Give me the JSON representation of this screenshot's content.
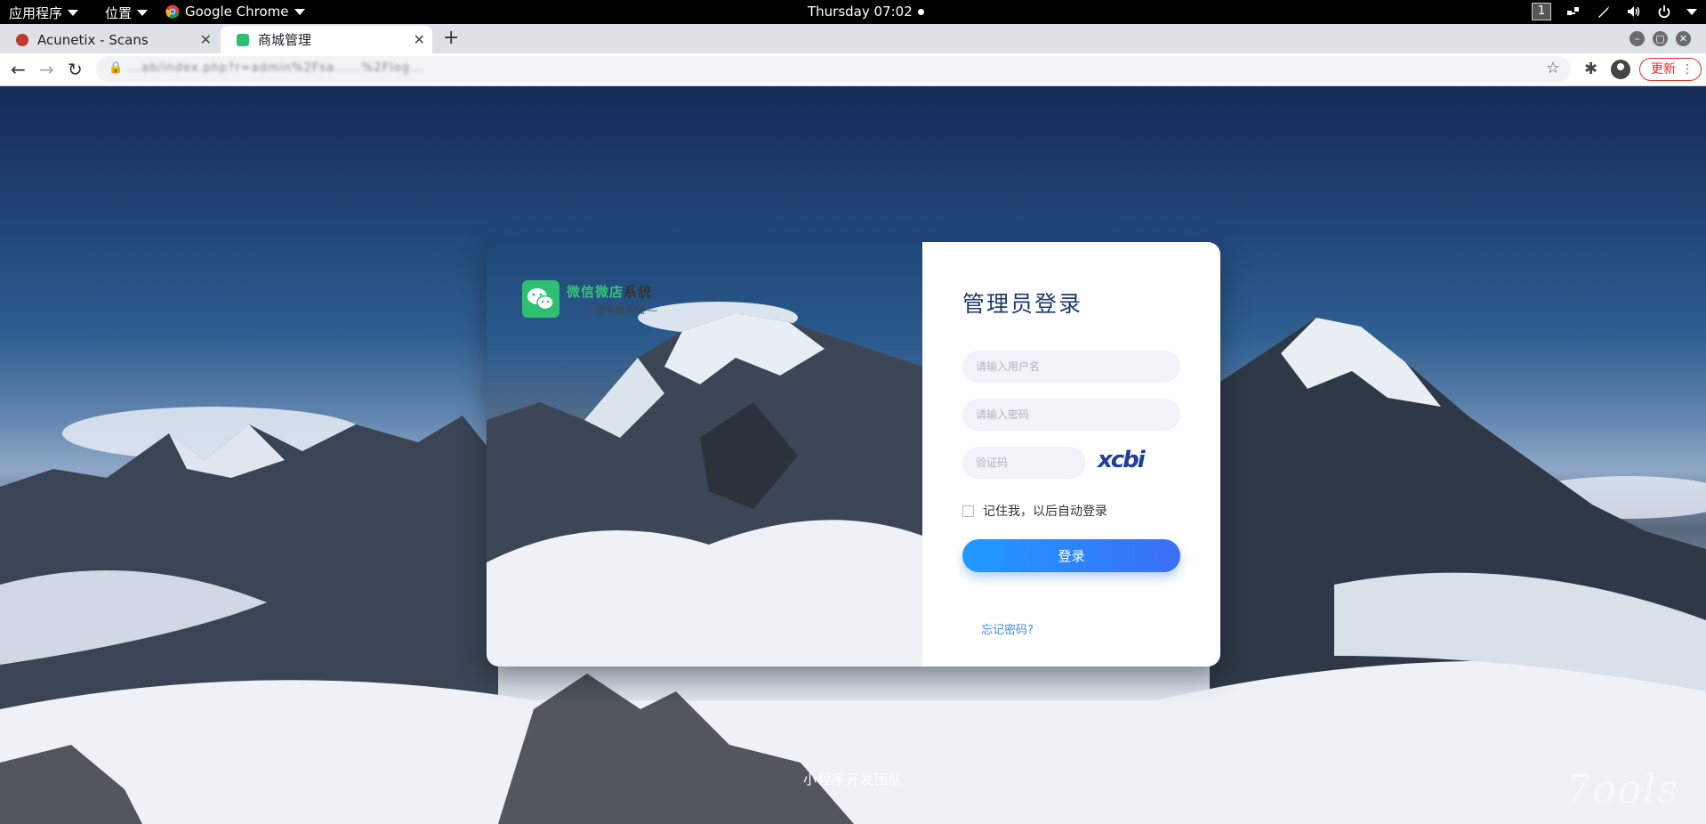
{
  "system_bar": {
    "apps_menu": "应用程序",
    "places_menu": "位置",
    "chrome_menu": "Google Chrome",
    "clock": "Thursday 07:02",
    "workspace": "1"
  },
  "browser": {
    "tabs": [
      {
        "title": "Acunetix - Scans",
        "active": false
      },
      {
        "title": "商城管理",
        "active": true
      }
    ],
    "url": "...ab/index.php?r=admin%2Fsa......%2Flog...",
    "update_label": "更新"
  },
  "login": {
    "brand_title_green": "微信微店",
    "brand_title_dark": "系统",
    "brand_subtitle": "— 微电商系统 —",
    "heading": "管理员登录",
    "username_placeholder": "请输入用户名",
    "password_placeholder": "请输入密码",
    "captcha_placeholder": "验证码",
    "captcha_text": "xcbi",
    "remember_label": "记住我，以后自动登录",
    "submit_label": "登录",
    "forgot_label": "忘记密码?"
  },
  "footer": {
    "team": "小程序开发团队",
    "watermark": "7ools"
  },
  "colors": {
    "accent": "#2f7af5",
    "brand_green": "#2fbf71",
    "heading": "#1e3a6b",
    "link": "#3f8bea"
  }
}
